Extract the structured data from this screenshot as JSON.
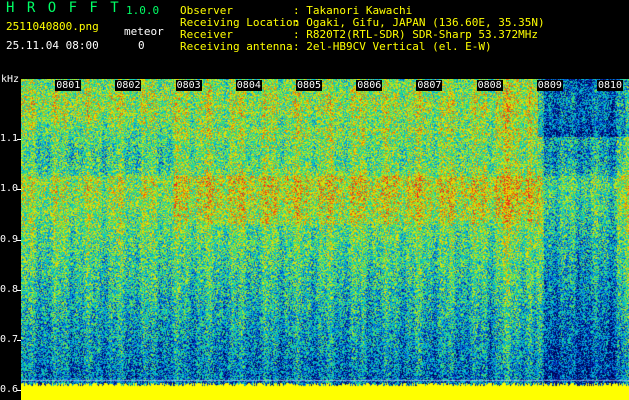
{
  "app": {
    "name": "H R O F F T",
    "version": "1.0.0",
    "filename": "2511040800.png",
    "datetime": "25.11.04 08:00"
  },
  "meteor": {
    "label": "meteor",
    "count": "0"
  },
  "info": [
    {
      "key": "Observer",
      "value": ": Takanori Kawachi"
    },
    {
      "key": "Receiving Location",
      "value": ": Ogaki, Gifu, JAPAN (136.60E, 35.35N)"
    },
    {
      "key": "Receiver",
      "value": ": R820T2(RTL-SDR) SDR-Sharp 53.372MHz"
    },
    {
      "key": "Receiving antenna",
      "value": ": 2el-HB9CV Vertical (el. E-W)"
    }
  ],
  "colors": {
    "title": "#00ff66",
    "info": "#ffff00",
    "text": "#ffffff",
    "floor": "#ffff00"
  },
  "chart_data": {
    "type": "heatmap",
    "ylabel": "kHz",
    "ylim": [
      0.58,
      1.22
    ],
    "yticks": [
      "1.1",
      "1.0",
      "0.9",
      "0.8",
      "0.7",
      "0.6"
    ],
    "ytick_values": [
      1.1,
      1.0,
      0.9,
      0.8,
      0.7,
      0.6
    ],
    "xticks": [
      "0801",
      "0802",
      "0803",
      "0804",
      "0805",
      "0806",
      "0807",
      "0808",
      "0809",
      "0810"
    ],
    "xtick_values": [
      1,
      2,
      3,
      4,
      5,
      6,
      7,
      8,
      9,
      10
    ],
    "xlim": [
      0,
      10.1
    ]
  }
}
